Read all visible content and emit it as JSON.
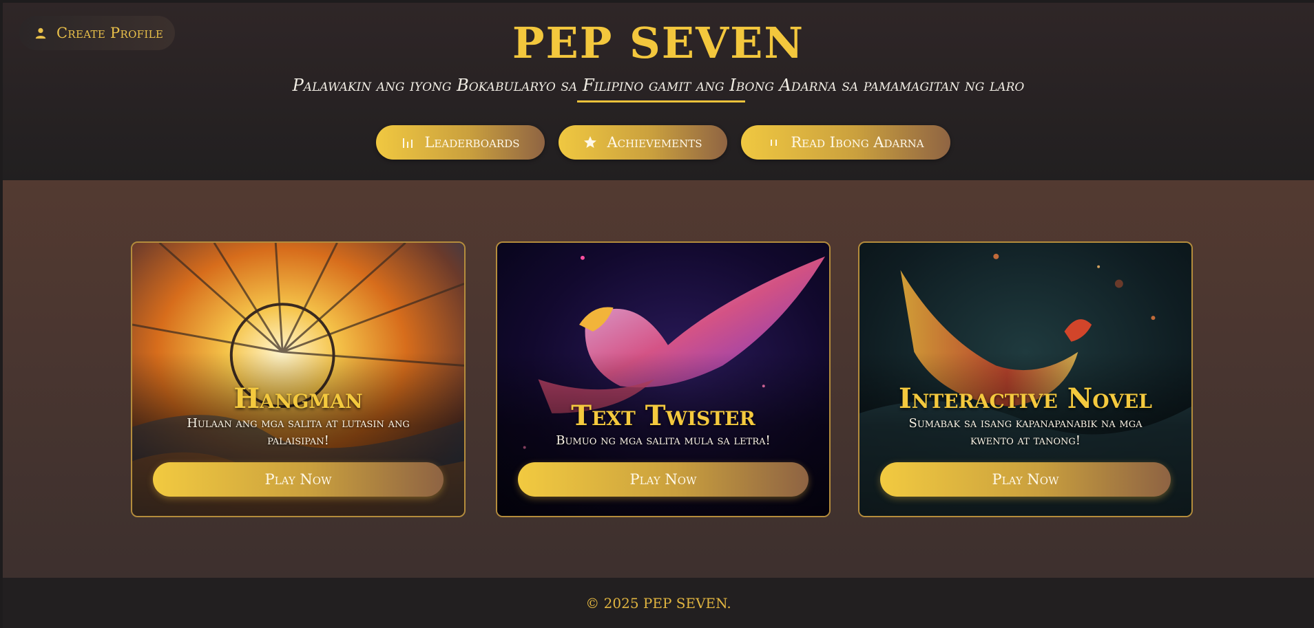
{
  "header": {
    "create_profile_label": "Create Profile",
    "title": "PEP SEVEN",
    "subtitle": "Palawakin ang iyong Bokabularyo sa Filipino gamit ang Ibong Adarna sa pamamagitan ng laro"
  },
  "nav": {
    "items": [
      {
        "label": "Leaderboards",
        "icon": "bar-chart-icon"
      },
      {
        "label": "Achievements",
        "icon": "star-icon"
      },
      {
        "label": "Read Ibong Adarna",
        "icon": "book-icon"
      }
    ]
  },
  "games": [
    {
      "title": "Hangman",
      "description": "Hulaan ang mga salita at lutasin ang palaisipan!",
      "button": "Play Now"
    },
    {
      "title": "Text Twister",
      "description": "Bumuo ng mga salita mula sa letra!",
      "button": "Play Now"
    },
    {
      "title": "Interactive Novel",
      "description": "Sumabak sa isang kapanapanabik na mga kwento at tanong!",
      "button": "Play Now"
    }
  ],
  "footer": {
    "copyright": "© 2025 PEP SEVEN."
  },
  "colors": {
    "accent": "#f3c73d",
    "background": "#201e1f",
    "content_bg": "#4a352f"
  }
}
